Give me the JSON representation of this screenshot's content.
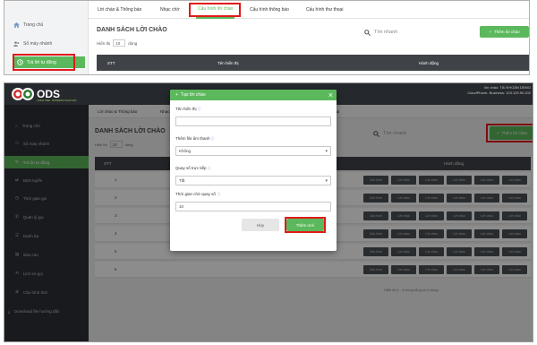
{
  "top": {
    "sidebar": [
      {
        "label": "Trang chủ",
        "icon": "home-icon"
      },
      {
        "label": "Số máy nhánh",
        "icon": "users-icon"
      },
      {
        "label": "Trả lời tự động",
        "icon": "auto-reply-icon"
      }
    ],
    "tabs": [
      "Lời chào & Thông báo",
      "Nhạc chờ",
      "Cấu hình lời chào",
      "Cấu hình thông báo",
      "Cấu hình thư thoại"
    ],
    "active_tab": 2,
    "title": "DANH SÁCH LỜI CHÀO",
    "show_label": "Hiển thị",
    "show_value": "10",
    "rows_label": "dòng",
    "search_placeholder": "Tìm nhanh",
    "add_label": "Thêm lời chào",
    "columns": [
      "STT",
      "Tên hiển thị",
      "Hành động"
    ]
  },
  "bottom": {
    "logo_text": "ODS",
    "logo_tagline": "VOICE TIME · BUSINESS SOLUTION",
    "user_line1": "Xin chào: TÀI KHOẢN DEMO",
    "user_line2": "CloudPhone- Business: 103.129.90.202",
    "sidebar": [
      {
        "label": "Trang chủ",
        "icon": "home-icon"
      },
      {
        "label": "Số máy nhánh",
        "icon": "users-icon"
      },
      {
        "label": "Trả lời tự động",
        "icon": "auto-reply-icon"
      },
      {
        "label": "Định tuyến",
        "icon": "route-icon"
      },
      {
        "label": "Thời gian gọi",
        "icon": "clock-icon"
      },
      {
        "label": "Quản lý gọi",
        "icon": "phone-icon"
      },
      {
        "label": "Danh bạ",
        "icon": "contacts-icon"
      },
      {
        "label": "Báo cáo",
        "icon": "report-icon"
      },
      {
        "label": "Lịch sử gọi",
        "icon": "history-icon"
      },
      {
        "label": "Cấu hình tính",
        "icon": "settings-icon"
      },
      {
        "label": "Download file hướng dẫn",
        "icon": "download-icon"
      }
    ],
    "tabs": [
      "Lời chào & Thông báo",
      "Nhạc chờ",
      "Cấu hình lời chào",
      "Cấu hình thông báo",
      "Cấu hình thư thoại"
    ],
    "active_tab": 2,
    "title": "DANH SÁCH LỜI CHÀO",
    "show_label": "Hiển thị",
    "show_value": "10",
    "rows_label": "dòng",
    "search_placeholder": "Tìm nhanh",
    "add_label": "Thêm lời chào",
    "columns": [
      "STT",
      "Tên hiển thị",
      "Hành động"
    ],
    "rows": [
      "1",
      "2",
      "3",
      "4",
      "5",
      "6"
    ],
    "row_actions": [
      "Cấu hình",
      "Lời chào",
      "Lời chào",
      "Lời chào",
      "Lời chào",
      "Lời chào"
    ],
    "footer": "Hiển thị 1 - 6 trong tổng số 6 dòng"
  },
  "modal": {
    "title": "Tạo lời chào",
    "name_label": "Tên hiển thị",
    "name_value": "",
    "sound_label": "Thêm file âm thanh",
    "sound_value": "Không",
    "direct_label": "Quay số trực tiếp",
    "direct_value": "Tắt",
    "wait_label": "Thời gian chờ quay số",
    "wait_value": "10",
    "cancel_label": "Hủy",
    "submit_label": "Thêm mới"
  },
  "colors": {
    "accent": "#5cb85c",
    "highlight": "#e01a1a",
    "dark": "#2e3135"
  }
}
